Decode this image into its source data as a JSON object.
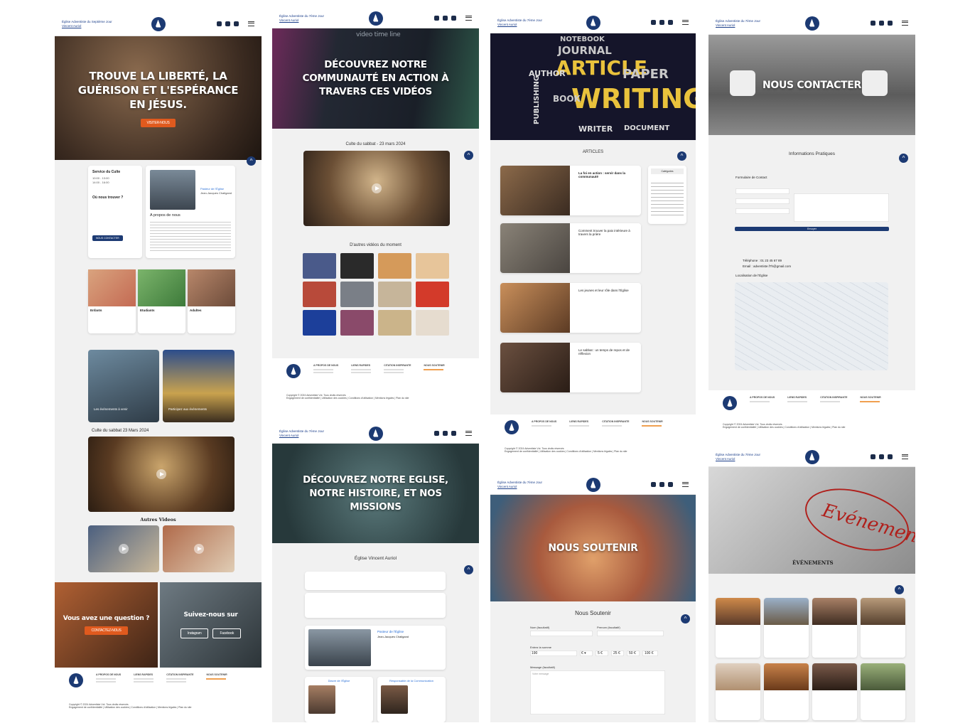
{
  "brand": {
    "name": "Église Adventiste du Septième Jour",
    "sub": "Vincent Auriol",
    "name_short": "Église Adventiste du 7ème Jour"
  },
  "home": {
    "hero_title": "Trouve la liberté, la guérison et l'espérance en Jésus.",
    "hero_button": "Visiter-nous",
    "service_title": "Service du Culte",
    "service_times": [
      "10:00 - 13:00",
      "14:00 - 16:00"
    ],
    "where_title": "Où nous trouver ?",
    "where_button": "Nous contacter",
    "pastor_name": "Pasteur de l'Église",
    "pastor_person": "Jean-Jacques Chaligand",
    "about_title": "A propos de nous",
    "groups": [
      "Enfants",
      "Etudiants",
      "Adultes"
    ],
    "events_left": "Les événements à venir",
    "events_right": "Participez aux événements",
    "culte_label": "Culte du sabbat 23 Mars 2024",
    "other_videos": "Autres Videos",
    "question": "Vous avez une question ?",
    "question_button": "Contactez-nous",
    "follow": "Suivez-nous sur",
    "follow_buttons": [
      "Instagram",
      "Facebook"
    ]
  },
  "videos": {
    "hero_title": "Découvrez notre communauté en action à travers ces vidéos",
    "hero_caption": "video time line",
    "main_label": "Culte du sabbat - 23 mars 2024",
    "more_label": "D'autres vidéos du moment"
  },
  "about": {
    "hero_title": "Découvrez notre Eglise, notre histoire, et nos missions",
    "section_title": "Église Vincent Auriol",
    "pastor_title": "Pasteur de l'Église",
    "pastor_person": "Jean-Jacques Chaligand",
    "team": [
      "Diacre de l'Église",
      "Responsable de la Communication"
    ]
  },
  "articles": {
    "hero_words": [
      "NOTEBOOK",
      "JOURNAL",
      "ARTICLE",
      "WRITING",
      "AUTHOR",
      "PUBLISHING",
      "DOCUMENT",
      "PAPER",
      "WRITER",
      "BOOK"
    ],
    "section_title": "ARTICLES",
    "categories_title": "Catégories",
    "items": [
      {
        "title": "La foi en action : servir dans la communauté"
      },
      {
        "title": "Comment trouver la paix intérieure à travers la prière"
      },
      {
        "title": "Les jeunes et leur rôle dans l'Église"
      },
      {
        "title": "Le sabbat : un temps de repos et de réflexion"
      }
    ]
  },
  "support": {
    "hero_title": "Nous Soutenir",
    "section_title": "Nous Soutenir",
    "nom_label": "Nom (facultatif)",
    "prenom_label": "Prenom (facultatif)",
    "amount_label": "Entrez la somme",
    "amount_value": "190",
    "currency": "€ ▾",
    "presets": [
      "5 €",
      "25 €",
      "50 €",
      "100 €"
    ],
    "message_label": "Message (facultatif)",
    "message_placeholder": "Votre message"
  },
  "contact": {
    "hero_title": "Nous contacter",
    "section_title": "Informations Pratiques",
    "form_title": "Formulaire de Contact",
    "send_button": "Envoyer",
    "phone": "Téléphone : 01 23 45 67 89",
    "email": "Email : adventiste.f7h@gmail.com",
    "map_label": "Localisation de l'Église"
  },
  "events": {
    "hero_word": "Evénement",
    "section_title": "ÉVÉNEMENTS"
  },
  "footer": {
    "cols": [
      "A PROPOS DE NOUS",
      "LIENS RAPIDES",
      "CITATION INSPIRANTE",
      "NOUS SOUTENIR"
    ],
    "links": "Engagement de confidentialité | Utilisation des cookies | Conditions d'utilisation | Mentions légales | Plan du site",
    "copyright": "Copyright © 2024 Adventiste Vct. Tous droits réservés"
  },
  "colors": {
    "navy": "#1c3a73",
    "orange": "#e05a1e"
  }
}
